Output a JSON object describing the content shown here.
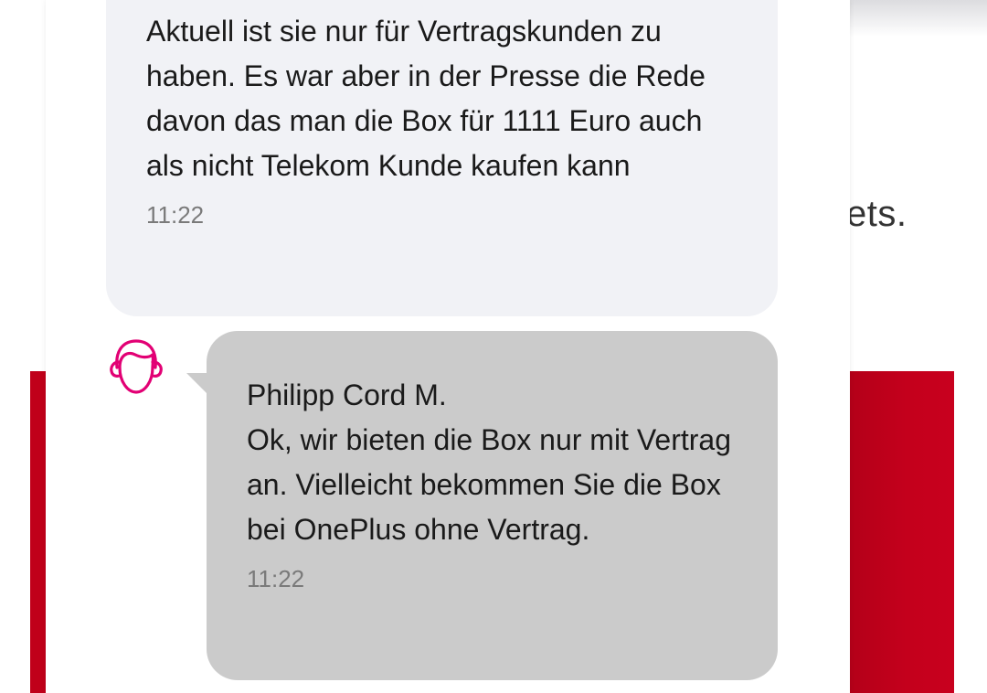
{
  "background": {
    "partial_text": "ets.",
    "accent_color": "#c0001a"
  },
  "chat": {
    "messages": [
      {
        "role": "user",
        "text": "Aktuell ist sie nur für Vertragskunden zu haben. Es war aber in der Presse die Rede davon das man die Box für 1111 Euro auch als nicht Telekom Kunde kaufen kann",
        "time": "11:22"
      },
      {
        "role": "agent",
        "sender": "Philipp Cord M.",
        "text": "Ok, wir bieten die Box nur mit Vertrag an. Vielleicht bekommen Sie die Box bei OnePlus ohne Vertrag.",
        "time": "11:22",
        "avatar_icon": "agent-avatar-icon",
        "avatar_color": "#e20074"
      }
    ]
  }
}
